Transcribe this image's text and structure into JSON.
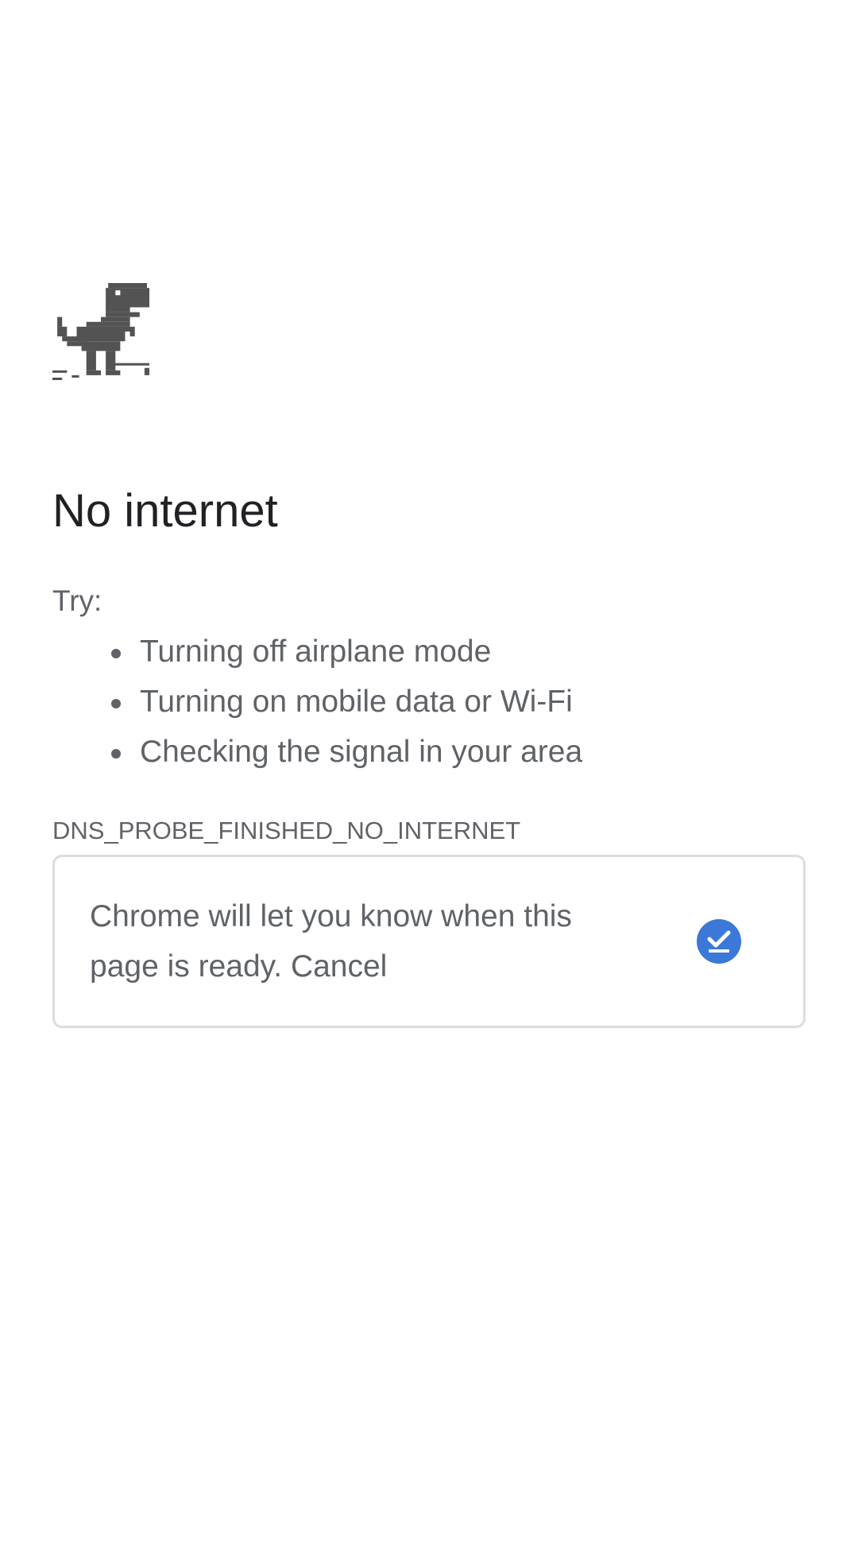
{
  "error_page": {
    "title": "No internet",
    "try_label": "Try:",
    "suggestions": [
      "Turning off airplane mode",
      "Turning on mobile data or Wi-Fi",
      "Checking the signal in your area"
    ],
    "error_code": "DNS_PROBE_FINISHED_NO_INTERNET"
  },
  "offline_card": {
    "message": "Chrome will let you know when this page is ready.",
    "cancel_label": "Cancel"
  },
  "icons": {
    "dino": "dino-icon",
    "check": "download-check-icon"
  },
  "colors": {
    "accent": "#3b78d8",
    "title_text": "#202124",
    "body_text": "#5f6368",
    "dino": "#535353",
    "card_border": "#dadce0"
  }
}
